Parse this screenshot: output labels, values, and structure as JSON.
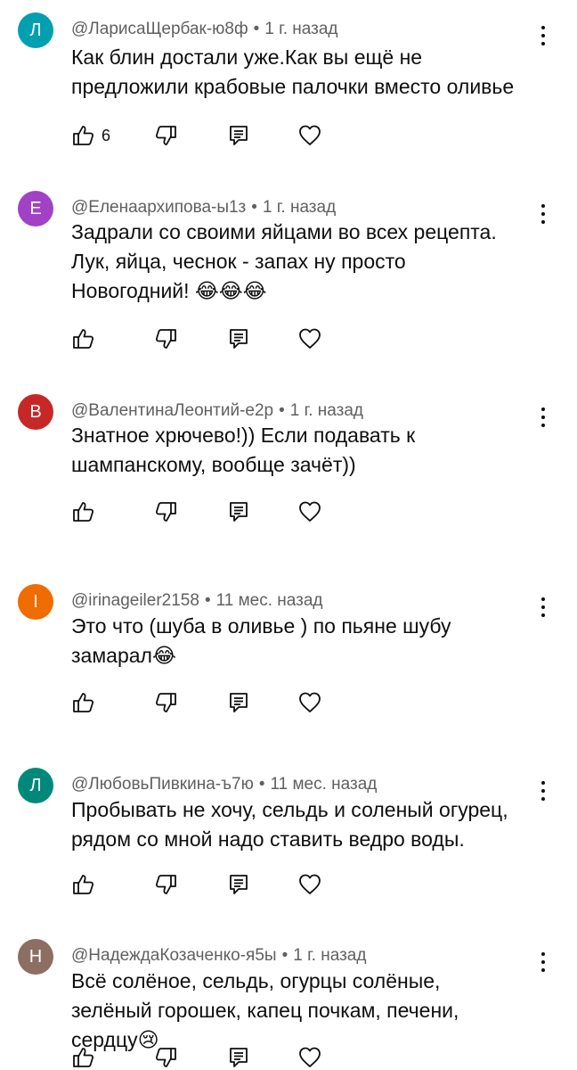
{
  "comments": [
    {
      "author": "@ЛарисаЩербак-ю8ф",
      "time": "1 г. назад",
      "initial": "Л",
      "avatar_color": "#00a0b0",
      "lines": [
        "Как блин достали уже.Как вы ещё не",
        "предложили крабовые палочки вместо оливье"
      ],
      "likes": "6"
    },
    {
      "author": "@Еленаархипова-ы1з",
      "time": "1 г. назад",
      "initial": "Е",
      "avatar_color": "#a142c5",
      "lines": [
        "Задрали со своими яйцами во всех рецепта.",
        "Лук, яйца, чеснок - запах ну просто",
        "Новогодний! 😂😂😂"
      ],
      "likes": ""
    },
    {
      "author": "@ВалентинаЛеонтий-е2р",
      "time": "1 г. назад",
      "initial": "В",
      "avatar_color": "#c62828",
      "lines": [
        "Знатное хрючево!)) Если подавать к",
        "шампанскому, вообще зачёт))"
      ],
      "likes": ""
    },
    {
      "author": "@irinageiler2158",
      "time": "11 мес. назад",
      "initial": "I",
      "avatar_color": "#ef6c00",
      "lines": [
        "Это что (шуба в оливье ) по пьяне шубу",
        "замарал😂"
      ],
      "likes": ""
    },
    {
      "author": "@ЛюбовьПивкина-ъ7ю",
      "time": "11 мес. назад",
      "initial": "Л",
      "avatar_color": "#00897b",
      "lines": [
        "Пробывать не хочу, сельдь и соленый огурец,",
        "рядом со мной надо ставить ведро воды."
      ],
      "likes": ""
    },
    {
      "author": "@НадеждаКозаченко-я5ы",
      "time": "1 г. назад",
      "initial": "Н",
      "avatar_color": "#8d6e63",
      "lines": [
        "Всё солёное, сельдь, огурцы солёные,",
        "зелёный горошек, капец почкам, печени,",
        "сердцу😢"
      ],
      "likes": ""
    }
  ],
  "icons": {
    "like": "thumb-up-icon",
    "dislike": "thumb-down-icon",
    "reply": "reply-icon",
    "heart": "heart-icon",
    "more": "more-vertical-icon"
  }
}
